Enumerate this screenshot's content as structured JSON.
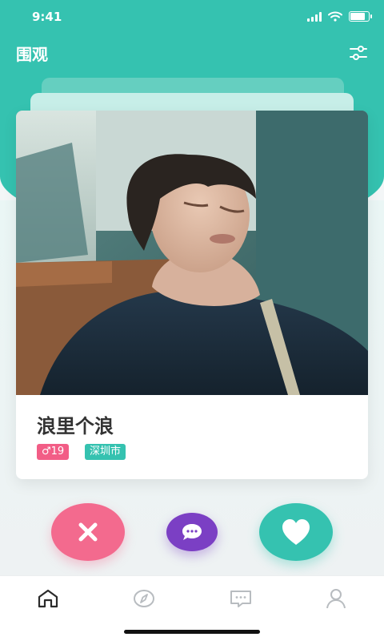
{
  "status_bar": {
    "time": "9:41"
  },
  "header": {
    "title": "围观",
    "filter_icon": "filter-sliders-icon"
  },
  "profile_card": {
    "name": "浪里个浪",
    "gender_symbol": "♂",
    "age": "19",
    "gender_age_label": "♂19",
    "city": "深圳市",
    "photo_description": "photo"
  },
  "actions": {
    "dislike_icon": "close-icon",
    "chat_icon": "chat-bubble-icon",
    "like_icon": "heart-icon"
  },
  "tabbar": {
    "items": [
      {
        "icon": "home-icon",
        "active": true
      },
      {
        "icon": "compass-icon",
        "active": false
      },
      {
        "icon": "message-icon",
        "active": false
      },
      {
        "icon": "profile-icon",
        "active": false
      }
    ]
  },
  "colors": {
    "accent": "#35c2b0",
    "pink": "#f36a8e",
    "purple": "#7b3fc4"
  }
}
